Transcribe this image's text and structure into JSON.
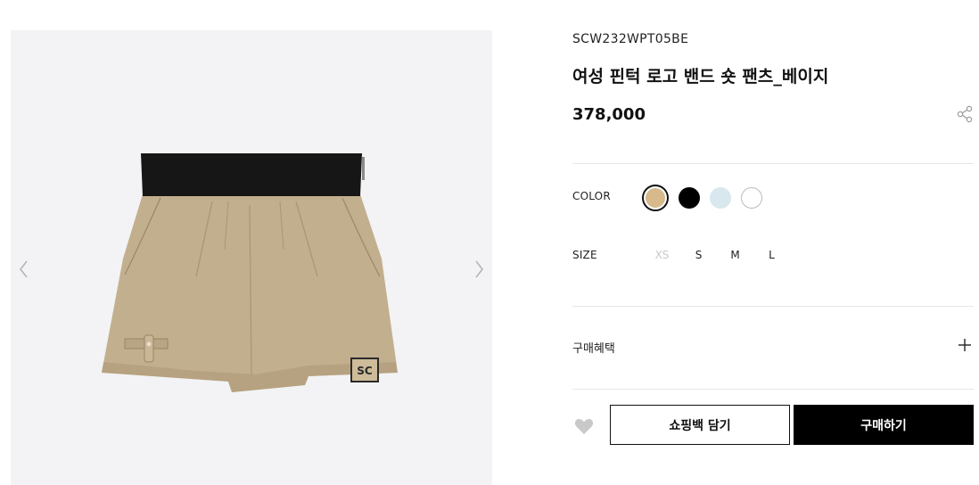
{
  "product": {
    "sku": "SCW232WPT05BE",
    "name": "여성 핀턱 로고 밴드 숏 팬츠_베이지",
    "price": "378,000"
  },
  "options": {
    "color_label": "COLOR",
    "colors": [
      {
        "name": "beige",
        "hex": "#d7b98c",
        "selected": true
      },
      {
        "name": "black",
        "hex": "#000000"
      },
      {
        "name": "light-blue",
        "hex": "#d9e7ee"
      },
      {
        "name": "white",
        "hex": "#ffffff"
      }
    ],
    "size_label": "SIZE",
    "sizes": [
      {
        "label": "XS",
        "available": false
      },
      {
        "label": "S",
        "available": true
      },
      {
        "label": "M",
        "available": true
      },
      {
        "label": "L",
        "available": true
      }
    ]
  },
  "benefit": {
    "label": "구매혜택"
  },
  "actions": {
    "add_to_bag": "쇼핑백 담기",
    "buy": "구매하기"
  },
  "colors": {
    "gallery_bg": "#f3f3f5",
    "product_beige": "#c2af8e",
    "waistband": "#161616",
    "primary_button": "#000000"
  }
}
